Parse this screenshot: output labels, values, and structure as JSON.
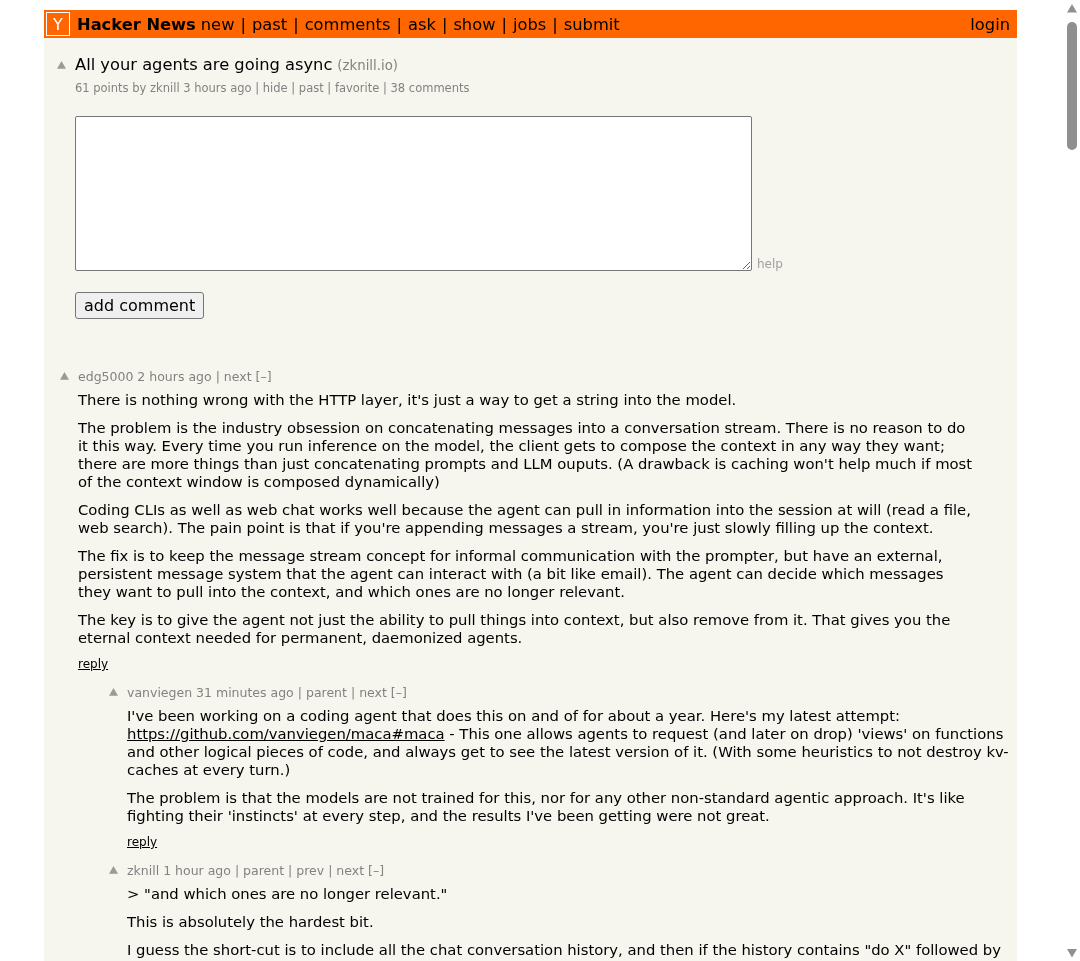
{
  "header": {
    "logo": "Y",
    "site_name": "Hacker News",
    "nav": [
      {
        "text": "new"
      },
      {
        "sep": "|",
        "text": "past"
      },
      {
        "sep": "|",
        "text": "comments"
      },
      {
        "sep": "|",
        "text": "ask"
      },
      {
        "sep": "|",
        "text": "show"
      },
      {
        "sep": "|",
        "text": "jobs"
      },
      {
        "sep": "|",
        "text": "submit"
      }
    ],
    "login": "login"
  },
  "story": {
    "title": "All your agents are going async",
    "site": "(zknill.io)",
    "subtext": {
      "score": "61 points",
      "byline": "by",
      "user": "zknill",
      "age": "3 hours ago",
      "links": [
        {
          "sep": "|",
          "text": "hide"
        },
        {
          "sep": "|",
          "text": "past"
        },
        {
          "sep": "|",
          "text": "favorite"
        },
        {
          "sep": "|",
          "text": "38 comments"
        }
      ]
    }
  },
  "comment_form": {
    "help": "help",
    "submit": "add comment"
  },
  "comments": [
    {
      "head": {
        "user": "edg5000",
        "age": "2 hours ago",
        "links": [
          {
            "sep": "|",
            "text": "next"
          }
        ],
        "toggle": "[–]"
      },
      "paragraphs": [
        [
          {
            "kind": "text",
            "text": "There is nothing wrong with the HTTP layer, it's just a way to get a string into the model."
          }
        ],
        [
          {
            "kind": "text",
            "text": "The problem is the industry obsession on concatenating messages into a conversation stream. There is no reason to do it this way. Every time you run inference on the model, the client gets to compose the context in any way they want; there are more things than just concatenating prompts and LLM ouputs. (A drawback is caching won't help much if most of the context window is composed dynamically)"
          }
        ],
        [
          {
            "kind": "text",
            "text": "Coding CLIs as well as web chat works well because the agent can pull in information into the session at will (read a file, web search). The pain point is that if you're appending messages a stream, you're just slowly filling up the context."
          }
        ],
        [
          {
            "kind": "text",
            "text": "The fix is to keep the message stream concept for informal communication with the prompter, but have an external, persistent message system that the agent can interact with (a bit like email). The agent can decide which messages they want to pull into the context, and which ones are no longer relevant."
          }
        ],
        [
          {
            "kind": "text",
            "text": "The key is to give the agent not just the ability to pull things into context, but also remove from it. That gives you the eternal context needed for permanent, daemonized agents."
          }
        ]
      ],
      "reply": "reply",
      "children": [
        {
          "head": {
            "user": "vanviegen",
            "age": "31 minutes ago",
            "links": [
              {
                "sep": "|",
                "text": "parent"
              },
              {
                "sep": "|",
                "text": "next"
              }
            ],
            "toggle": "[–]"
          },
          "paragraphs": [
            [
              {
                "kind": "text",
                "text": "I've been working on a coding agent that does this on and of for about a year. Here's my latest attempt:"
              },
              {
                "kind": "link",
                "text": "https://github.com/vanviegen/maca#maca"
              },
              {
                "kind": "text",
                "text": "- This one allows agents to request (and later on drop) 'views' on functions and other logical pieces of code, and always get to see the latest version of it. (With some heuristics to not destroy kv-caches at every turn.)"
              }
            ],
            [
              {
                "kind": "text",
                "text": "The problem is that the models are not trained for this, nor for any other non-standard agentic approach. It's like fighting their 'instincts' at every step, and the results I've been getting were not great."
              }
            ]
          ],
          "reply": "reply"
        },
        {
          "head": {
            "user": "zknill",
            "age": "1 hour ago",
            "links": [
              {
                "sep": "|",
                "text": "parent"
              },
              {
                "sep": "|",
                "text": "prev"
              },
              {
                "sep": "|",
                "text": "next"
              }
            ],
            "toggle": "[–]"
          },
          "paragraphs": [
            [
              {
                "kind": "text",
                "text": "> \"and which ones are no longer relevant.\""
              }
            ],
            [
              {
                "kind": "text",
                "text": "This is absolutely the hardest bit."
              }
            ],
            [
              {
                "kind": "text",
                "text": "I guess the short-cut is to include all the chat conversation history, and then if the history contains \"do X\" followed by"
              }
            ]
          ]
        }
      ]
    }
  ]
}
